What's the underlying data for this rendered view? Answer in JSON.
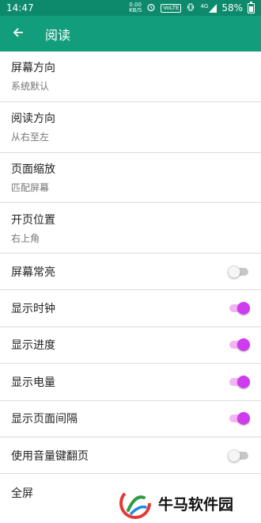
{
  "status": {
    "time": "14:47",
    "net_speed_value": "0.00",
    "net_speed_unit": "KB/S",
    "volte": "VoLTE",
    "signal": "4G",
    "battery": "58%"
  },
  "app_bar": {
    "title": "阅读",
    "back_icon": "arrow-back-icon",
    "color": "#129e7c"
  },
  "settings": [
    {
      "title": "屏幕方向",
      "value": "系统默认"
    },
    {
      "title": "阅读方向",
      "value": "从右至左"
    },
    {
      "title": "页面缩放",
      "value": "匹配屏幕"
    },
    {
      "title": "开页位置",
      "value": "右上角"
    }
  ],
  "toggles": [
    {
      "label": "屏幕常亮",
      "on": false
    },
    {
      "label": "显示时钟",
      "on": true
    },
    {
      "label": "显示进度",
      "on": true
    },
    {
      "label": "显示电量",
      "on": true
    },
    {
      "label": "显示页面间隔",
      "on": true
    },
    {
      "label": "使用音量键翻页",
      "on": false
    },
    {
      "label": "全屏",
      "on": null
    }
  ],
  "watermark": {
    "text": "牛马软件园"
  },
  "colors": {
    "accent_on": "#cf3cf0",
    "status_bar": "#0d8a6b"
  }
}
